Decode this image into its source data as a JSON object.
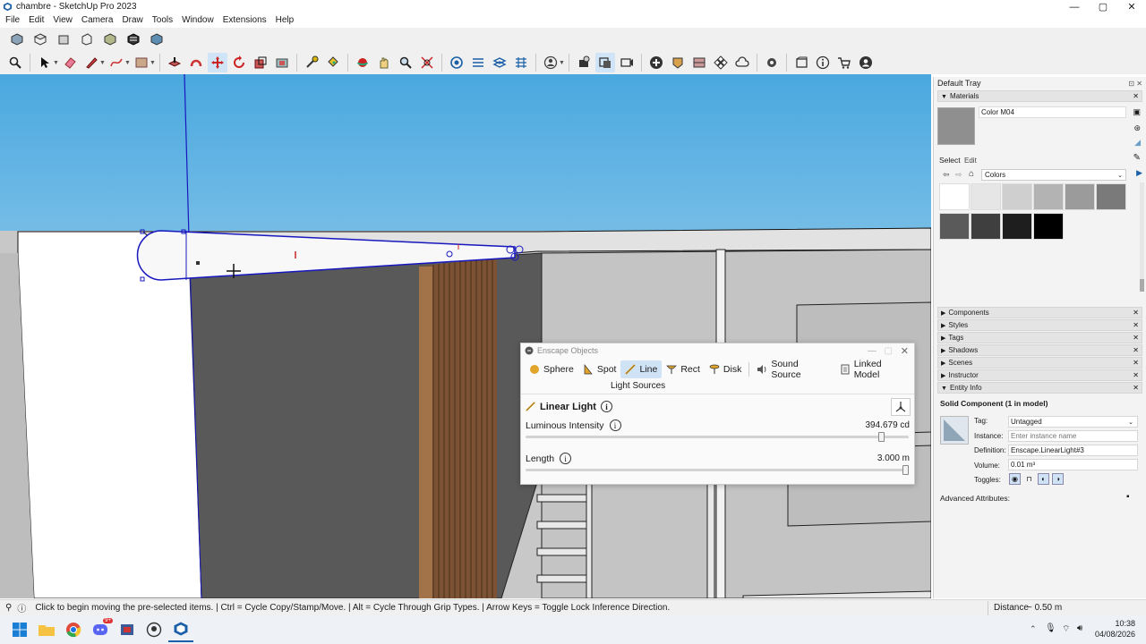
{
  "window": {
    "title": "chambre - SketchUp Pro 2023",
    "minimize": "—",
    "maximize": "▢",
    "close": "✕"
  },
  "menu": [
    "File",
    "Edit",
    "View",
    "Camera",
    "Draw",
    "Tools",
    "Window",
    "Extensions",
    "Help"
  ],
  "enscape": {
    "title": "Enscape Objects",
    "tabs": [
      {
        "label": "Sphere",
        "icon": "sphere-icon"
      },
      {
        "label": "Spot",
        "icon": "spot-icon"
      },
      {
        "label": "Line",
        "icon": "line-icon",
        "active": true
      },
      {
        "label": "Rect",
        "icon": "rect-icon"
      },
      {
        "label": "Disk",
        "icon": "disk-icon"
      },
      {
        "label": "Sound Source",
        "icon": "speaker-icon"
      },
      {
        "label": "Linked Model",
        "icon": "linked-model-icon"
      }
    ],
    "section_label": "Light Sources",
    "heading": "Linear Light",
    "intensity_label": "Luminous Intensity",
    "intensity_value": "394.679 cd",
    "intensity_fraction": 0.93,
    "length_label": "Length",
    "length_value": "3.000 m",
    "length_fraction": 1.0
  },
  "tray": {
    "title": "Default Tray",
    "materials": {
      "header": "Materials",
      "current_name": "Color M04",
      "select_tab": "Select",
      "edit_tab": "Edit",
      "library": "Colors",
      "swatches": [
        "#ffffff",
        "#e6e6e6",
        "#cfcfcf",
        "#b3b3b3",
        "#9b9b9b",
        "#7a7a7a",
        "#5a5a5a",
        "#3f3f3f",
        "#1e1e1e",
        "#000000"
      ]
    },
    "panels": [
      "Components",
      "Styles",
      "Tags",
      "Shadows",
      "Scenes",
      "Instructor",
      "Entity Info"
    ],
    "entity_info": {
      "title": "Solid Component (1 in model)",
      "tag_label": "Tag:",
      "tag_value": "Untagged",
      "instance_label": "Instance:",
      "instance_placeholder": "Enter instance name",
      "definition_label": "Definition:",
      "definition_value": "Enscape.LinearLight#3",
      "volume_label": "Volume:",
      "volume_value": "0.01 m³",
      "toggles_label": "Toggles:",
      "advanced_label": "Advanced Attributes:"
    }
  },
  "status": {
    "message": "Click to begin moving the pre-selected items. | Ctrl = Cycle Copy/Stamp/Move. | Alt = Cycle Through Grip Types. | Arrow Keys = Toggle Lock Inference Direction.",
    "measurement_label": "Distance",
    "measurement_value": "~ 0.50 m"
  },
  "taskbar": {
    "time": "10:38",
    "date": "04/08/2026",
    "discord_badge": "9+"
  },
  "colors": {
    "sky_top": "#4aa8df",
    "sky_bottom": "#d8ecf8",
    "accent": "#1a5fa8",
    "selection": "#1818c0"
  }
}
